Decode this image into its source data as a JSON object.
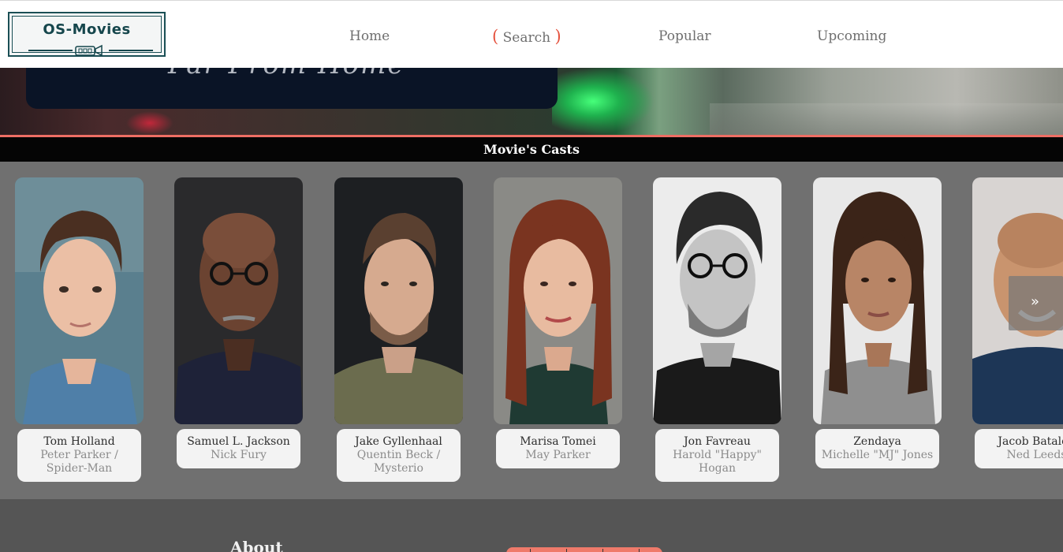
{
  "header": {
    "logo_text": "OS-Movies",
    "nav": [
      {
        "label": "Home"
      },
      {
        "label": "Search"
      },
      {
        "label": "Popular"
      },
      {
        "label": "Upcoming"
      }
    ],
    "search_bracket_color": "#e5533f"
  },
  "hero": {
    "title_fragment": "Far From Home"
  },
  "cast_section": {
    "title": "Movie's Casts",
    "next_icon": "double-chevron-right-icon",
    "cast": [
      {
        "actor": "Tom Holland",
        "role": "Peter Parker / Spider-Man"
      },
      {
        "actor": "Samuel L. Jackson",
        "role": "Nick Fury"
      },
      {
        "actor": "Jake Gyllenhaal",
        "role": "Quentin Beck / Mysterio"
      },
      {
        "actor": "Marisa Tomei",
        "role": "May Parker"
      },
      {
        "actor": "Jon Favreau",
        "role": "Harold \"Happy\" Hogan"
      },
      {
        "actor": "Zendaya",
        "role": "Michelle \"MJ\" Jones"
      },
      {
        "actor": "Jacob Batalon",
        "role": "Ned Leeds"
      }
    ]
  },
  "footer": {
    "about_label": "About"
  },
  "colors": {
    "accent": "#ee6e64",
    "logo": "#15464c",
    "cast_background": "#707070",
    "footer_background": "#555555"
  }
}
